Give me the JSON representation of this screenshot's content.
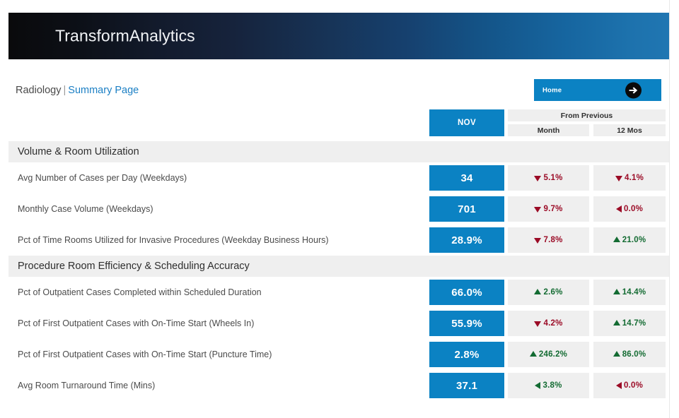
{
  "app": {
    "title": "TransformAnalytics",
    "banner_gradient_from": "#0a0a0c",
    "banner_gradient_to": "#2076b2"
  },
  "breadcrumb": {
    "root": "Radiology",
    "separator": "|",
    "current": "Summary Page",
    "link_color": "#1b7fc4"
  },
  "home_button": {
    "label": "Home",
    "icon": "arrow-right-circle-icon",
    "background": "#0b82c3"
  },
  "columns": {
    "value_header": "NOV",
    "group_header": "From Previous",
    "sub_headers": [
      "Month",
      "12 Mos"
    ],
    "value_header_bg": "#0b82c3",
    "delta_header_bg": "#efefef"
  },
  "colors": {
    "positive": "#136b32",
    "negative": "#9b0b26",
    "accent": "#0b82c3",
    "band": "#efefef"
  },
  "sections": [
    {
      "title": "Volume & Room Utilization",
      "rows": [
        {
          "label": "Avg Number of Cases per Day (Weekdays)",
          "value": "34",
          "month": {
            "text": "5.1%",
            "direction": "down",
            "tone": "negative"
          },
          "mos12": {
            "text": "4.1%",
            "direction": "down",
            "tone": "negative"
          }
        },
        {
          "label": "Monthly Case Volume (Weekdays)",
          "value": "701",
          "month": {
            "text": "9.7%",
            "direction": "down",
            "tone": "negative"
          },
          "mos12": {
            "text": "0.0%",
            "direction": "left",
            "tone": "negative"
          }
        },
        {
          "label": "Pct of Time Rooms Utilized for Invasive Procedures (Weekday Business Hours)",
          "value": "28.9%",
          "month": {
            "text": "7.8%",
            "direction": "down",
            "tone": "negative"
          },
          "mos12": {
            "text": "21.0%",
            "direction": "up",
            "tone": "positive"
          }
        }
      ]
    },
    {
      "title": "Procedure Room Efficiency & Scheduling Accuracy",
      "rows": [
        {
          "label": "Pct of Outpatient Cases Completed within Scheduled Duration",
          "value": "66.0%",
          "month": {
            "text": "2.6%",
            "direction": "up",
            "tone": "positive"
          },
          "mos12": {
            "text": "14.4%",
            "direction": "up",
            "tone": "positive"
          }
        },
        {
          "label": "Pct of First Outpatient Cases with On-Time Start (Wheels In)",
          "value": "55.9%",
          "month": {
            "text": "4.2%",
            "direction": "down",
            "tone": "negative"
          },
          "mos12": {
            "text": "14.7%",
            "direction": "up",
            "tone": "positive"
          }
        },
        {
          "label": "Pct of First Outpatient Cases with On-Time Start (Puncture Time)",
          "value": "2.8%",
          "month": {
            "text": "246.2%",
            "direction": "up",
            "tone": "positive"
          },
          "mos12": {
            "text": "86.0%",
            "direction": "up",
            "tone": "positive"
          }
        },
        {
          "label": "Avg Room Turnaround Time (Mins)",
          "value": "37.1",
          "month": {
            "text": "3.8%",
            "direction": "left",
            "tone": "positive"
          },
          "mos12": {
            "text": "0.0%",
            "direction": "left",
            "tone": "negative"
          }
        }
      ]
    }
  ]
}
